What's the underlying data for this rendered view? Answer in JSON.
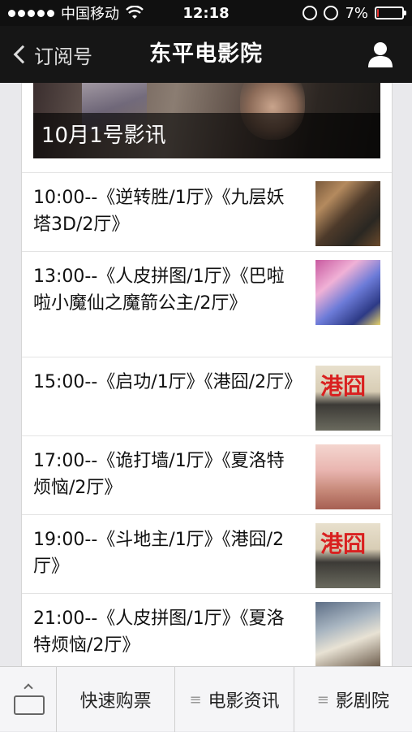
{
  "statusbar": {
    "carrier": "中国移动",
    "time": "12:18",
    "battery": "7%",
    "battery_fraction": 0.07
  },
  "navbar": {
    "back_label": "订阅号",
    "title": "东平电影院"
  },
  "article": {
    "cover_title": "10月1号影讯",
    "schedule": [
      {
        "text": "10:00--《逆转胜/1厅》《九层妖塔3D/2厅》"
      },
      {
        "text": "13:00--《人皮拼图/1厅》《巴啦啦小魔仙之魔箭公主/2厅》"
      },
      {
        "text": "15:00--《启功/1厅》《港囧/2厅》",
        "poster_text": "港囧"
      },
      {
        "text": "17:00--《诡打墙/1厅》《夏洛特烦恼/2厅》"
      },
      {
        "text": "19:00--《斗地主/1厅》《港囧/2厅》",
        "poster_text": "港囧"
      },
      {
        "text": "21:00--《人皮拼图/1厅》《夏洛特烦恼/2厅》"
      }
    ]
  },
  "bottom_menu": {
    "items": [
      {
        "label": "快速购票"
      },
      {
        "label": "电影资讯"
      },
      {
        "label": "影剧院"
      }
    ],
    "menu_glyph": "≡"
  }
}
